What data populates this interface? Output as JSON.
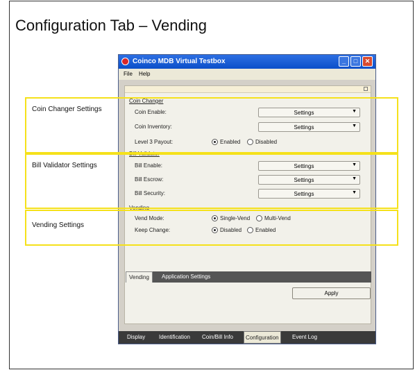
{
  "slide_title": "Configuration Tab – Vending",
  "window": {
    "title": "Coinco MDB Virtual Testbox",
    "buttons": {
      "minimize": "_",
      "maximize": "□",
      "close": "✕"
    },
    "menu": [
      "File",
      "Help"
    ]
  },
  "coin_changer": {
    "heading": "Coin Changer",
    "coin_enable_label": "Coin Enable:",
    "coin_enable_value": "Settings",
    "coin_inventory_label": "Coin Inventory:",
    "coin_inventory_value": "Settings",
    "level3_label": "Level 3 Payout:",
    "level3_options": [
      "Enabled",
      "Disabled"
    ],
    "level3_selected": "Enabled"
  },
  "bill_validator": {
    "heading": "Bill Validator",
    "bill_enable_label": "Bill Enable:",
    "bill_enable_value": "Settings",
    "bill_escrow_label": "Bill Escrow:",
    "bill_escrow_value": "Settings",
    "bill_security_label": "Bill Security:",
    "bill_security_value": "Settings"
  },
  "vending": {
    "heading": "Vending",
    "vend_mode_label": "Vend Mode:",
    "vend_mode_options": [
      "Single-Vend",
      "Multi-Vend"
    ],
    "vend_mode_selected": "Single-Vend",
    "keep_change_label": "Keep Change:",
    "keep_change_options": [
      "Disabled",
      "Enabled"
    ],
    "keep_change_selected": "Disabled"
  },
  "sub_tabs": [
    "Vending",
    "Application Settings"
  ],
  "sub_tab_active": "Vending",
  "apply_label": "Apply",
  "bottom_tabs": [
    "Display",
    "Identification",
    "Coin/Bill Info",
    "Configuration",
    "Event Log"
  ],
  "bottom_tab_active": "Configuration",
  "annotations": {
    "coin_changer": "Coin Changer Settings",
    "bill_validator": "Bill Validator Settings",
    "vending": "Vending Settings"
  },
  "highlight_color": "#f5e11a"
}
